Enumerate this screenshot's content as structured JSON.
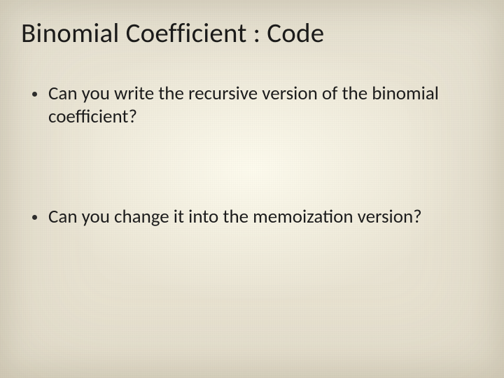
{
  "title": "Binomial Coefficient : Code",
  "bullets": [
    {
      "text": "Can you write the recursive version of the binomial coefficient?"
    },
    {
      "text": "Can you change it into the memoization version?"
    }
  ]
}
